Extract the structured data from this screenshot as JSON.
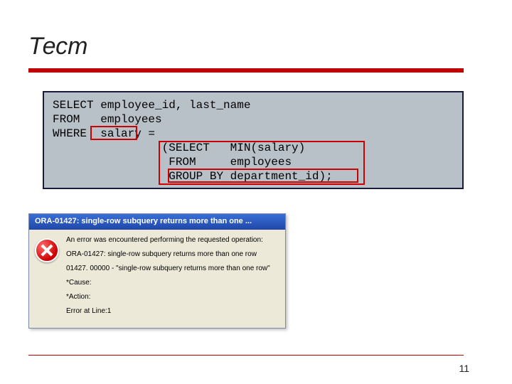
{
  "title": "Тест",
  "sql": {
    "line1": "SELECT employee_id, last_name",
    "line2": "FROM   employees",
    "line3": "WHERE  salary =",
    "line4": "                (SELECT   MIN(salary)",
    "line5": "                 FROM     employees",
    "line6": "                 GROUP BY department_id);"
  },
  "highlights": {
    "salary_box": "salary",
    "subquery_box": "(SELECT ... GROUP BY department_id)",
    "group_by_box": "GROUP BY department_id)"
  },
  "dialog": {
    "title": "ORA-01427: single-row subquery returns more than one ...",
    "p1": "An error was encountered performing the requested operation:",
    "p2": "ORA-01427: single-row subquery returns more than one row",
    "p3": "01427. 00000 -  \"single-row subquery returns more than one row\"",
    "p4": "*Cause:",
    "p5": "*Action:",
    "p6": "Error at Line:1"
  },
  "page_number": "11"
}
